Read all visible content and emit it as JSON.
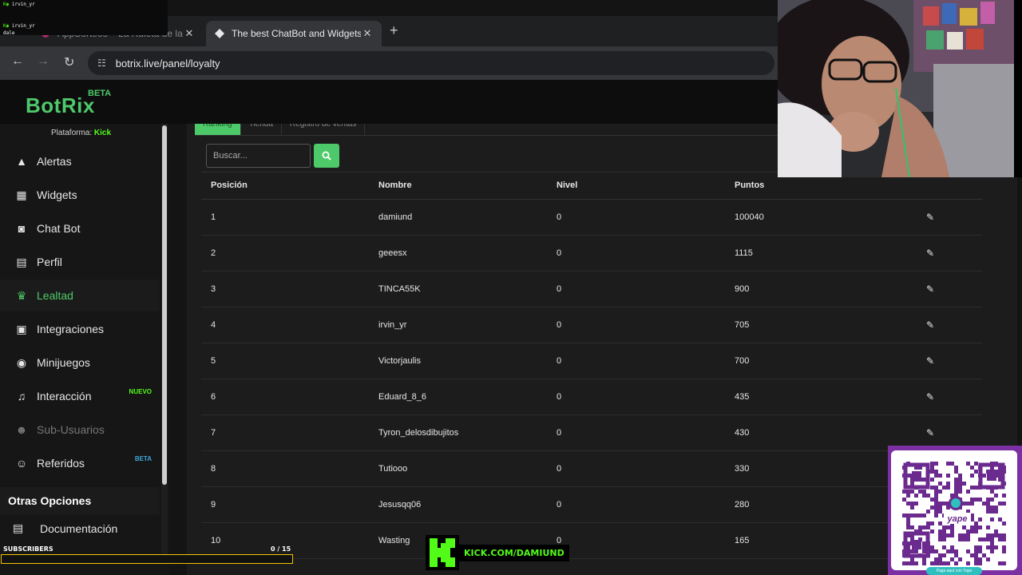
{
  "chat_overlay": {
    "lines": [
      "irvin_yr",
      "",
      "",
      "irvin_yr",
      "dale"
    ]
  },
  "browser": {
    "tabs": [
      {
        "title": "AppSorteos – La Ruleta de la Su",
        "active": false
      },
      {
        "title": "The best ChatBot and Widgets f",
        "active": true
      }
    ],
    "url": "botrix.live/panel/loyalty"
  },
  "app": {
    "logo": "BotRix",
    "logo_badge": "BETA",
    "platform_label": "Plataforma:",
    "platform_value": "Kick"
  },
  "sidebar": {
    "items": [
      {
        "label": "Alertas",
        "icon": "warning-icon"
      },
      {
        "label": "Widgets",
        "icon": "grid-icon"
      },
      {
        "label": "Chat Bot",
        "icon": "robot-icon"
      },
      {
        "label": "Perfil",
        "icon": "id-card-icon"
      },
      {
        "label": "Lealtad",
        "icon": "trophy-icon",
        "active": true
      },
      {
        "label": "Integraciones",
        "icon": "integrations-icon"
      },
      {
        "label": "Minijuegos",
        "icon": "gamepad-icon"
      },
      {
        "label": "Interacción",
        "icon": "music-icon",
        "badge": "NUEVO"
      },
      {
        "label": "Sub-Usuarios",
        "icon": "users-icon",
        "disabled": true
      },
      {
        "label": "Referidos",
        "icon": "referral-icon",
        "badge": "BETA"
      }
    ],
    "section_title": "Otras Opciones",
    "doc_label": "Documentación",
    "colors": {
      "accent": "#4ec969",
      "nuevo": "#53fc18",
      "beta": "#3fa9d8"
    }
  },
  "panel": {
    "tabs": [
      "Ranking",
      "Tienda",
      "Registro de ventas"
    ],
    "search_placeholder": "Buscar...",
    "columns": [
      "Posición",
      "Nombre",
      "Nivel",
      "Puntos"
    ],
    "rows": [
      {
        "pos": "1",
        "name": "damiund",
        "level": "0",
        "points": "100040"
      },
      {
        "pos": "2",
        "name": "geeesx",
        "level": "0",
        "points": "1115"
      },
      {
        "pos": "3",
        "name": "TINCA55K",
        "level": "0",
        "points": "900"
      },
      {
        "pos": "4",
        "name": "irvin_yr",
        "level": "0",
        "points": "705"
      },
      {
        "pos": "5",
        "name": "Victorjaulis",
        "level": "0",
        "points": "700"
      },
      {
        "pos": "6",
        "name": "Eduard_8_6",
        "level": "0",
        "points": "435"
      },
      {
        "pos": "7",
        "name": "Tyron_delosdibujitos",
        "level": "0",
        "points": "430"
      },
      {
        "pos": "8",
        "name": "Tutiooo",
        "level": "0",
        "points": "330"
      },
      {
        "pos": "9",
        "name": "Jesusqq06",
        "level": "0",
        "points": "280"
      },
      {
        "pos": "10",
        "name": "Wasting",
        "level": "0",
        "points": "165"
      }
    ]
  },
  "stream_overlay": {
    "subscribers_label": "SUBSCRIBERS",
    "subscribers_count": "0  / 15",
    "subscribers_progress": 0,
    "kick_url": "KICK.COM/DAMIUND",
    "qr_caption": "Paga aquí con Yape",
    "qr_brand": "yape"
  }
}
